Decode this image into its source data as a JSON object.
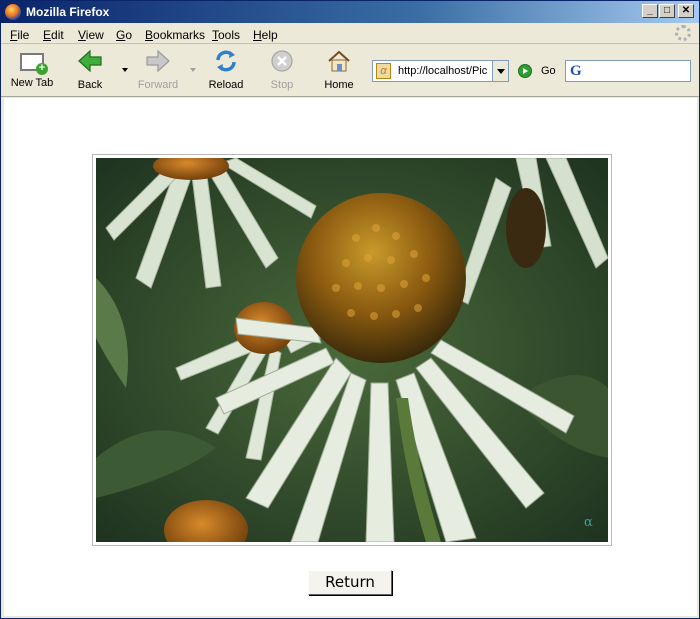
{
  "window": {
    "title": "Mozilla Firefox",
    "min_glyph": "_",
    "max_glyph": "□",
    "close_glyph": "✕"
  },
  "menubar": {
    "items": [
      {
        "accel": "F",
        "rest": "ile"
      },
      {
        "accel": "E",
        "rest": "dit"
      },
      {
        "accel": "V",
        "rest": "iew"
      },
      {
        "accel": "G",
        "rest": "o"
      },
      {
        "accel": "B",
        "rest": "ookmarks"
      },
      {
        "accel": "T",
        "rest": "ools"
      },
      {
        "accel": "H",
        "rest": "elp"
      }
    ]
  },
  "toolbar": {
    "new_tab": "New Tab",
    "back": "Back",
    "forward": "Forward",
    "reload": "Reload",
    "stop": "Stop",
    "home": "Home",
    "go": "Go"
  },
  "urlbar": {
    "value": "http://localhost/Pic",
    "favicon_glyph": "α"
  },
  "searchbar": {
    "engine_glyph": "G",
    "value": ""
  },
  "content": {
    "return_button": "Return",
    "photo_watermark": "α"
  },
  "colors": {
    "title_bar": "#0a246a",
    "chrome": "#ece9d8",
    "page": "#ffffff"
  }
}
